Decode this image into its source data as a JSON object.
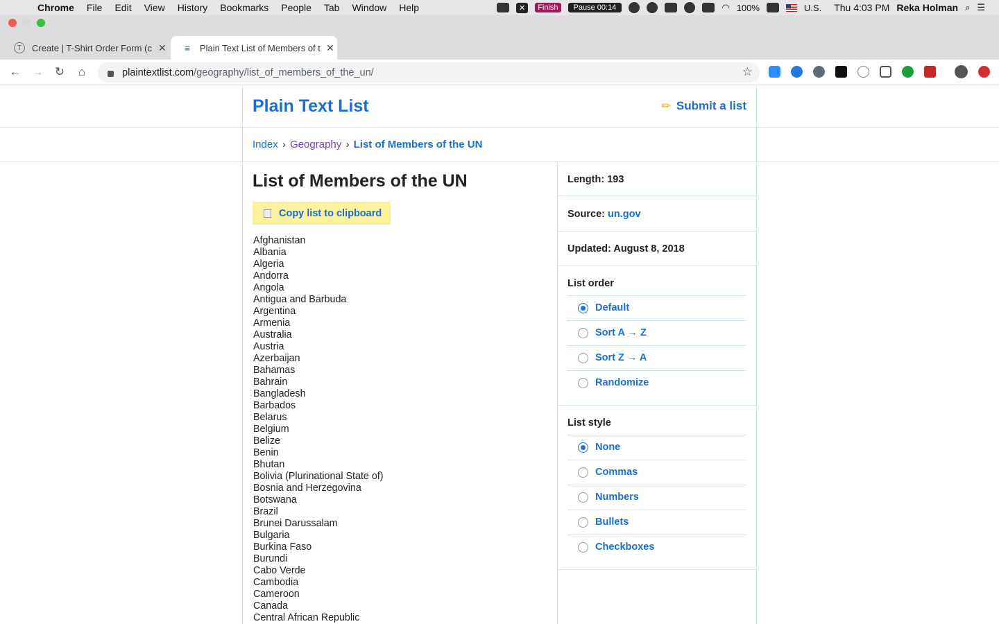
{
  "menubar": {
    "app": "Chrome",
    "items": [
      "File",
      "Edit",
      "View",
      "History",
      "Bookmarks",
      "People",
      "Tab",
      "Window",
      "Help"
    ],
    "finish": "Finish",
    "pause": "Pause 00:14",
    "battery": "100%",
    "input_source": "U.S.",
    "clock": "Thu 4:03 PM",
    "user": "Reka Holman"
  },
  "tabs": [
    {
      "title": "Create | T-Shirt Order Form (c",
      "favicon": "T"
    },
    {
      "title": "Plain Text List of Members of t",
      "favicon": "≡"
    }
  ],
  "address": {
    "domain": "plaintextlist.com",
    "path": "/geography/list_of_members_of_the_un/"
  },
  "site": {
    "brand": "Plain Text List",
    "submit": "Submit a list"
  },
  "breadcrumb": {
    "index": "Index",
    "category": "Geography",
    "current": "List of Members of the UN",
    "sep": "›"
  },
  "list": {
    "title": "List of Members of the UN",
    "copy_label": "Copy list to clipboard",
    "items": [
      "Afghanistan",
      "Albania",
      "Algeria",
      "Andorra",
      "Angola",
      "Antigua and Barbuda",
      "Argentina",
      "Armenia",
      "Australia",
      "Austria",
      "Azerbaijan",
      "Bahamas",
      "Bahrain",
      "Bangladesh",
      "Barbados",
      "Belarus",
      "Belgium",
      "Belize",
      "Benin",
      "Bhutan",
      "Bolivia (Plurinational State of)",
      "Bosnia and Herzegovina",
      "Botswana",
      "Brazil",
      "Brunei Darussalam",
      "Bulgaria",
      "Burkina Faso",
      "Burundi",
      "Cabo Verde",
      "Cambodia",
      "Cameroon",
      "Canada",
      "Central African Republic"
    ]
  },
  "sidebar": {
    "length_label": "Length:",
    "length_value": "193",
    "source_label": "Source:",
    "source_value": "un.gov",
    "updated_label": "Updated:",
    "updated_value": "August 8, 2018",
    "order_title": "List order",
    "order_options": [
      "Default",
      "Sort A → Z",
      "Sort Z → A",
      "Randomize"
    ],
    "style_title": "List style",
    "style_options": [
      "None",
      "Commas",
      "Numbers",
      "Bullets",
      "Checkboxes"
    ]
  },
  "colors": {
    "link": "#1a6fd1",
    "visited": "#7b3fb8",
    "highlight": "#fbf19e",
    "rule": "#cfe4ec"
  }
}
